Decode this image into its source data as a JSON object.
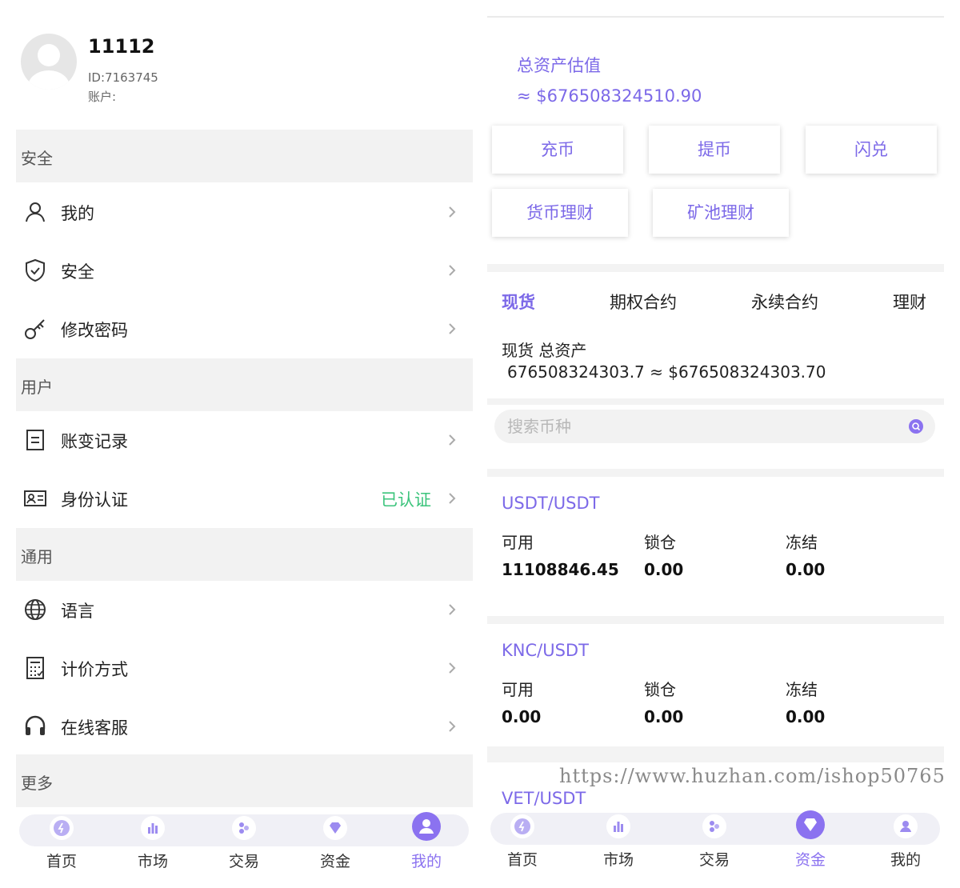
{
  "profile": {
    "username": "11112",
    "id": "ID:7163745",
    "account": "账户:"
  },
  "left": {
    "sections": [
      "安全",
      "用户",
      "通用",
      "更多"
    ],
    "rows": [
      {
        "label": "我的",
        "icon": "user-icon"
      },
      {
        "label": "安全",
        "icon": "shield-icon"
      },
      {
        "label": "修改密码",
        "icon": "key-icon"
      },
      {
        "label": "账变记录",
        "icon": "document-icon"
      },
      {
        "label": "身份认证",
        "icon": "id-card-icon",
        "status": "已认证"
      },
      {
        "label": "语言",
        "icon": "globe-icon"
      },
      {
        "label": "计价方式",
        "icon": "calculator-icon"
      },
      {
        "label": "在线客服",
        "icon": "headset-icon"
      }
    ]
  },
  "tabbar": {
    "items": [
      {
        "label": "首页",
        "icon": "home-icon"
      },
      {
        "label": "市场",
        "icon": "market-icon"
      },
      {
        "label": "交易",
        "icon": "trade-icon"
      },
      {
        "label": "资金",
        "icon": "diamond-icon"
      },
      {
        "label": "我的",
        "icon": "profile-icon"
      }
    ],
    "left_active": "我的",
    "right_active": "资金"
  },
  "assets": {
    "title": "总资产估值",
    "value": "≈ $676508324510.90",
    "buttons": [
      "充币",
      "提币",
      "闪兑",
      "货币理财",
      "矿池理财"
    ],
    "tabs": [
      "现货",
      "期权合约",
      "永续合约",
      "理财"
    ],
    "spot_title": "现货 总资产",
    "spot_value": "676508324303.7 ≈ $676508324303.70",
    "search_placeholder": "搜索币种",
    "columns": [
      "可用",
      "锁仓",
      "冻结"
    ],
    "pairs": [
      {
        "name": "USDT/USDT",
        "available": "11108846.45",
        "locked": "0.00",
        "frozen": "0.00"
      },
      {
        "name": "KNC/USDT",
        "available": "0.00",
        "locked": "0.00",
        "frozen": "0.00"
      },
      {
        "name": "VET/USDT"
      }
    ]
  },
  "watermark": "https://www.huzhan.com/ishop50765",
  "colors": {
    "accent": "#7c69e8",
    "verified": "#3cc47c",
    "section_bg": "#f2f2f2"
  }
}
